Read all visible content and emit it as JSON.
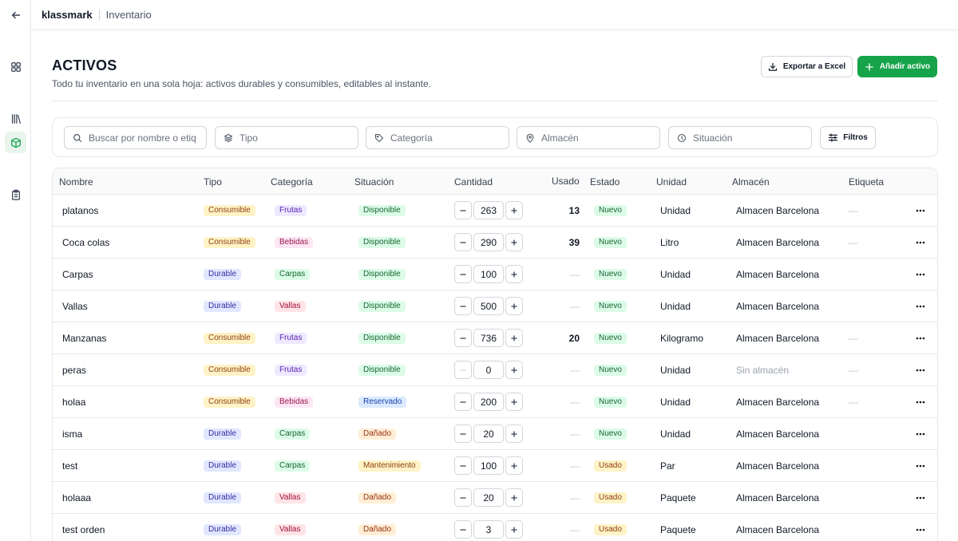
{
  "topbar": {
    "brand": "klassmark",
    "breadcrumb": "Inventario"
  },
  "header": {
    "title": "ACTIVOS",
    "subtitle": "Todo tu inventario en una sola hoja: activos durables y consumibles, editables al instante.",
    "export_label": "Exportar a Excel",
    "add_label": "Añadir activo"
  },
  "filters": {
    "search_placeholder": "Buscar por nombre o etiqueta",
    "tipo": "Tipo",
    "categoria": "Categoría",
    "almacen": "Almacén",
    "situacion": "Situación",
    "filtros_label": "Filtros"
  },
  "colors": {
    "accent": "#16a34a"
  },
  "table": {
    "columns": [
      "Nombre",
      "Tipo",
      "Categoría",
      "Situación",
      "Cantidad",
      "Usado",
      "Estado",
      "Unidad",
      "Almacén",
      "Etiqueta"
    ],
    "rows": [
      {
        "nombre": "platanos",
        "tipo": "Consumible",
        "categoria": "Frutas",
        "situacion": "Disponible",
        "cantidad": "263",
        "usado": "13",
        "estado": "Nuevo",
        "unidad": "Unidad",
        "almacen": "Almacen Barcelona",
        "etiqueta": "—"
      },
      {
        "nombre": "Coca colas",
        "tipo": "Consumible",
        "categoria": "Bebidas",
        "situacion": "Disponible",
        "cantidad": "290",
        "usado": "39",
        "estado": "Nuevo",
        "unidad": "Litro",
        "almacen": "Almacen Barcelona",
        "etiqueta": "—"
      },
      {
        "nombre": "Carpas",
        "tipo": "Durable",
        "categoria": "Carpas",
        "situacion": "Disponible",
        "cantidad": "100",
        "usado": "—",
        "estado": "Nuevo",
        "unidad": "Unidad",
        "almacen": "Almacen Barcelona",
        "etiqueta": ""
      },
      {
        "nombre": "Vallas",
        "tipo": "Durable",
        "categoria": "Vallas",
        "situacion": "Disponible",
        "cantidad": "500",
        "usado": "—",
        "estado": "Nuevo",
        "unidad": "Unidad",
        "almacen": "Almacen Barcelona",
        "etiqueta": ""
      },
      {
        "nombre": "Manzanas",
        "tipo": "Consumible",
        "categoria": "Frutas",
        "situacion": "Disponible",
        "cantidad": "736",
        "usado": "20",
        "estado": "Nuevo",
        "unidad": "Kilogramo",
        "almacen": "Almacen Barcelona",
        "etiqueta": "—"
      },
      {
        "nombre": "peras",
        "tipo": "Consumible",
        "categoria": "Frutas",
        "situacion": "Disponible",
        "cantidad": "0",
        "usado": "—",
        "estado": "Nuevo",
        "unidad": "Unidad",
        "almacen": "Sin almacén",
        "etiqueta": "—"
      },
      {
        "nombre": "holaa",
        "tipo": "Consumible",
        "categoria": "Bebidas",
        "situacion": "Reservado",
        "cantidad": "200",
        "usado": "—",
        "estado": "Nuevo",
        "unidad": "Unidad",
        "almacen": "Almacen Barcelona",
        "etiqueta": "—"
      },
      {
        "nombre": "isma",
        "tipo": "Durable",
        "categoria": "Carpas",
        "situacion": "Dañado",
        "cantidad": "20",
        "usado": "—",
        "estado": "Nuevo",
        "unidad": "Unidad",
        "almacen": "Almacen Barcelona",
        "etiqueta": ""
      },
      {
        "nombre": "test",
        "tipo": "Durable",
        "categoria": "Carpas",
        "situacion": "Mantenimiento",
        "cantidad": "100",
        "usado": "—",
        "estado": "Usado",
        "unidad": "Par",
        "almacen": "Almacen Barcelona",
        "etiqueta": ""
      },
      {
        "nombre": "holaaa",
        "tipo": "Durable",
        "categoria": "Vallas",
        "situacion": "Dañado",
        "cantidad": "20",
        "usado": "—",
        "estado": "Usado",
        "unidad": "Paquete",
        "almacen": "Almacen Barcelona",
        "etiqueta": ""
      },
      {
        "nombre": "test orden",
        "tipo": "Durable",
        "categoria": "Vallas",
        "situacion": "Dañado",
        "cantidad": "3",
        "usado": "—",
        "estado": "Usado",
        "unidad": "Paquete",
        "almacen": "Almacen Barcelona",
        "etiqueta": ""
      }
    ]
  }
}
